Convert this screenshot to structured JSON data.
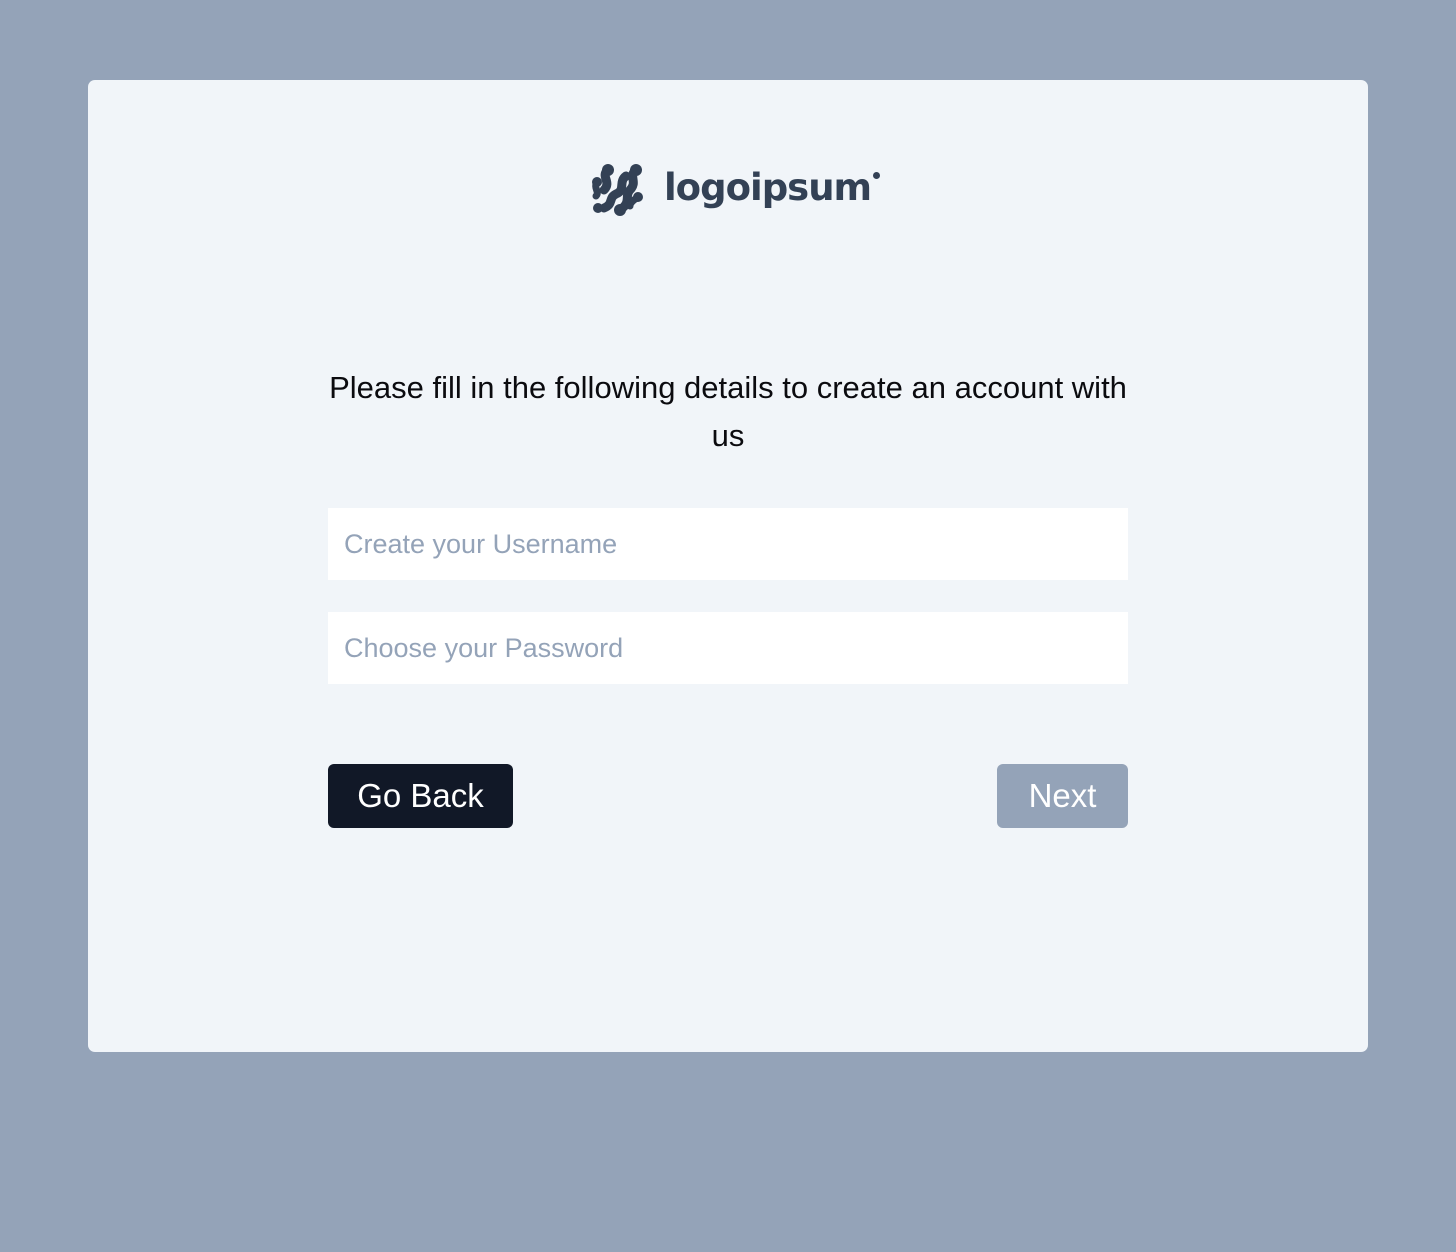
{
  "brand": {
    "name": "logoipsum",
    "logo_icon": "logoipsum-mark-icon",
    "color": "#334155"
  },
  "form": {
    "instruction": "Please fill in the following details to create an account with us",
    "username_placeholder": "Create your Username",
    "username_value": "",
    "password_placeholder": "Choose your Password",
    "password_value": ""
  },
  "actions": {
    "back_label": "Go Back",
    "next_label": "Next"
  },
  "colors": {
    "page_background": "#94a3b8",
    "card_background": "#f1f5f9",
    "primary_button": "#111827",
    "disabled_button": "#94a3b8"
  }
}
